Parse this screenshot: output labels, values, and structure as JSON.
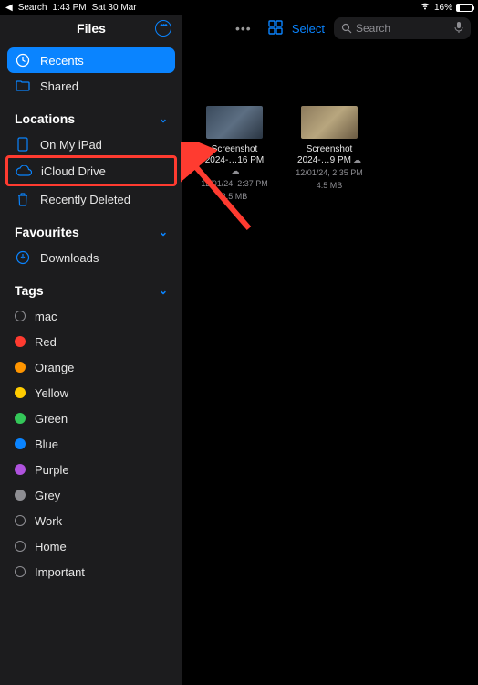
{
  "statusBar": {
    "back": "Search",
    "time": "1:43 PM",
    "date": "Sat 30 Mar",
    "batteryPercent": "16%"
  },
  "sidebar": {
    "title": "Files",
    "topItems": [
      {
        "label": "Recents"
      },
      {
        "label": "Shared"
      }
    ],
    "locations": {
      "title": "Locations",
      "items": [
        {
          "label": "On My iPad"
        },
        {
          "label": "iCloud Drive"
        },
        {
          "label": "Recently Deleted"
        }
      ]
    },
    "favourites": {
      "title": "Favourites",
      "items": [
        {
          "label": "Downloads"
        }
      ]
    },
    "tags": {
      "title": "Tags",
      "items": [
        {
          "label": "mac",
          "color": ""
        },
        {
          "label": "Red",
          "color": "#ff3b30"
        },
        {
          "label": "Orange",
          "color": "#ff9500"
        },
        {
          "label": "Yellow",
          "color": "#ffcc00"
        },
        {
          "label": "Green",
          "color": "#34c759"
        },
        {
          "label": "Blue",
          "color": "#0a84ff"
        },
        {
          "label": "Purple",
          "color": "#af52de"
        },
        {
          "label": "Grey",
          "color": "#8e8e93"
        },
        {
          "label": "Work",
          "color": ""
        },
        {
          "label": "Home",
          "color": ""
        },
        {
          "label": "Important",
          "color": ""
        }
      ]
    }
  },
  "toolbar": {
    "select": "Select",
    "searchPlaceholder": "Search"
  },
  "files": [
    {
      "name1": "Screenshot",
      "name2": "2024-…16 PM",
      "date": "12/01/24, 2:37 PM",
      "size": "3.5 MB"
    },
    {
      "name1": "Screenshot",
      "name2": "2024-…9 PM",
      "date": "12/01/24, 2:35 PM",
      "size": "4.5 MB"
    }
  ]
}
